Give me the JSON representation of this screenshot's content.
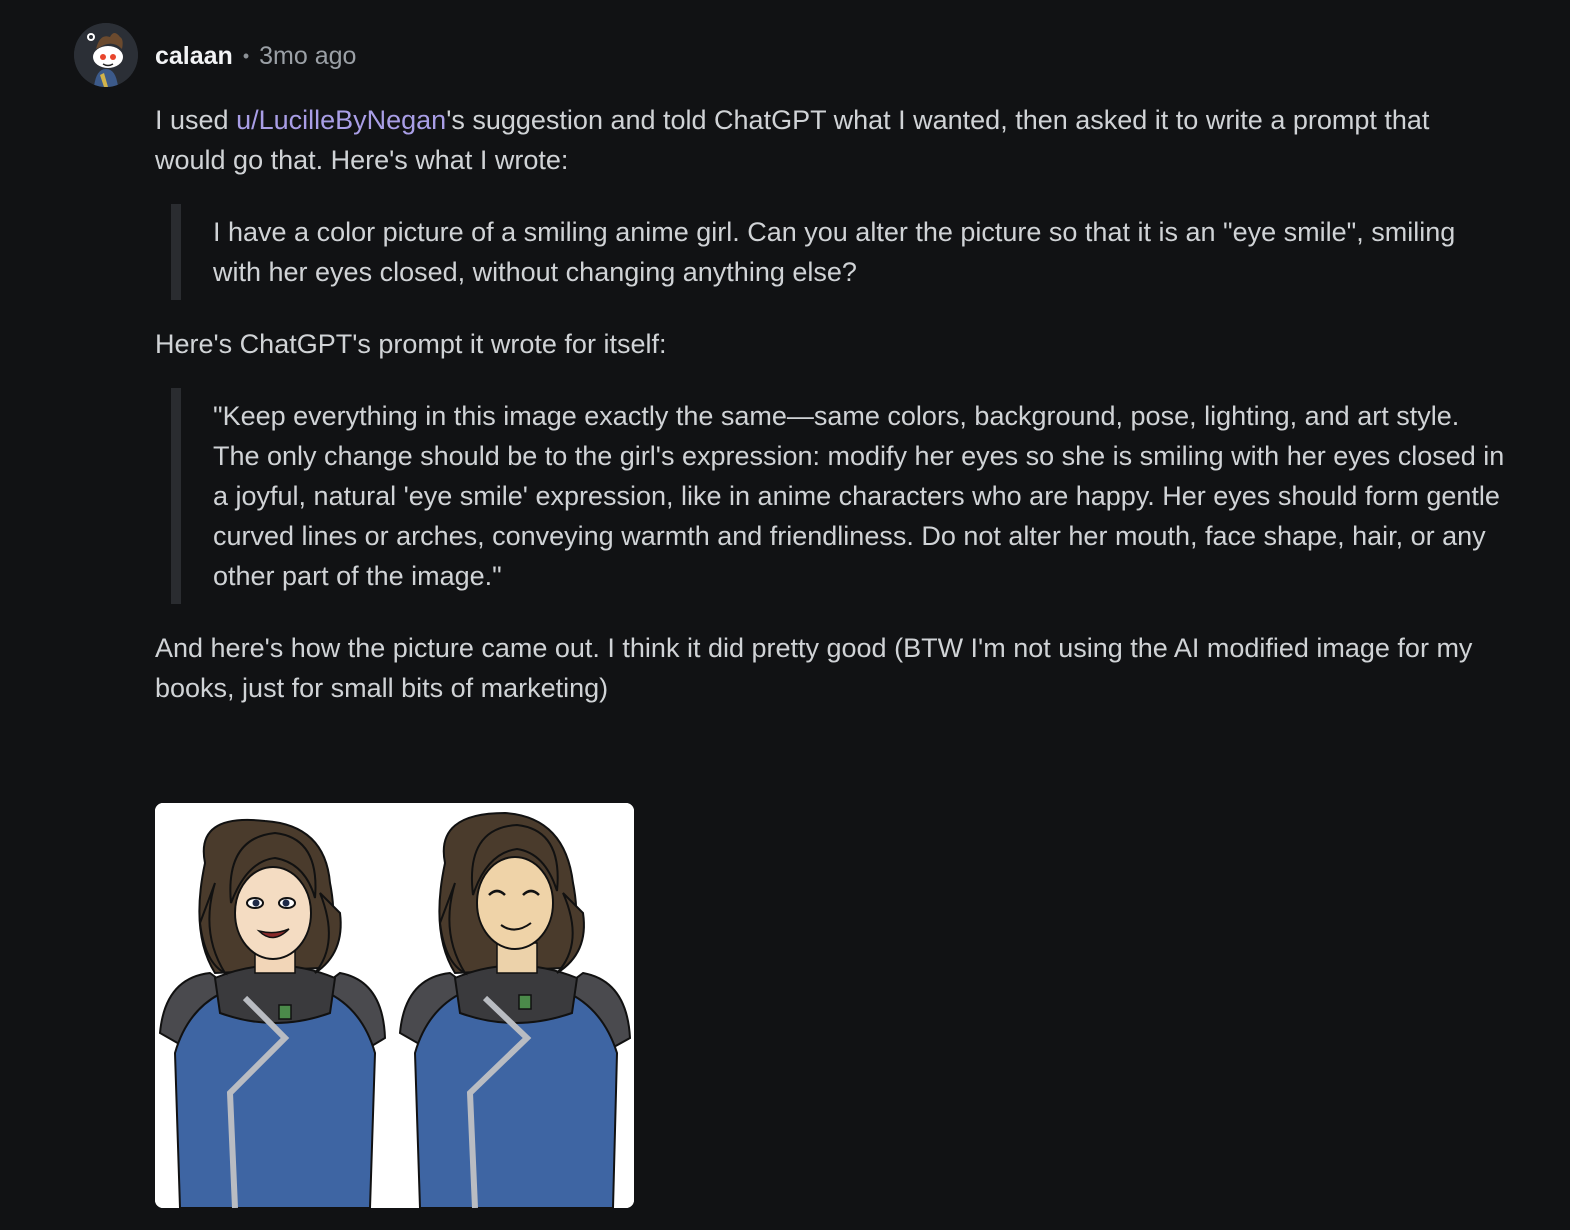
{
  "comment": {
    "author": "calaan",
    "separator": "•",
    "timestamp": "3mo ago",
    "avatar_icon": "snoo-avatar-icon",
    "intro_before_link": "I used ",
    "mention_link": "u/LucilleByNegan",
    "intro_after_link": "'s suggestion and told ChatGPT what I wanted, then asked it to write a prompt that would go that. Here's what I wrote:",
    "quote_1": "I have a color picture of a smiling anime girl. Can you alter the picture so that it is an \"eye smile\", smiling with her eyes closed, without changing anything else?",
    "middle_text": "Here's ChatGPT's prompt it wrote for itself:",
    "quote_2": "\"Keep everything in this image exactly the same—same colors, background, pose, lighting, and art style. The only change should be to the girl's expression: modify her eyes so she is smiling with her eyes closed in a joyful, natural 'eye smile' expression, like in anime characters who are happy. Her eyes should form gentle curved lines or arches, conveying warmth and friendliness. Do not alter her mouth, face shape, hair, or any other part of the image.\"",
    "closing_text": "And here's how the picture came out. I think it did pretty good (BTW I'm not using the AI modified image for my books, just for small bits of marketing)",
    "image_icon": "anime-girl-comparison-image"
  },
  "colors": {
    "background": "#111214",
    "text": "#d0d3d6",
    "link": "#a99ee6",
    "quote_bar": "#2a2c30"
  }
}
